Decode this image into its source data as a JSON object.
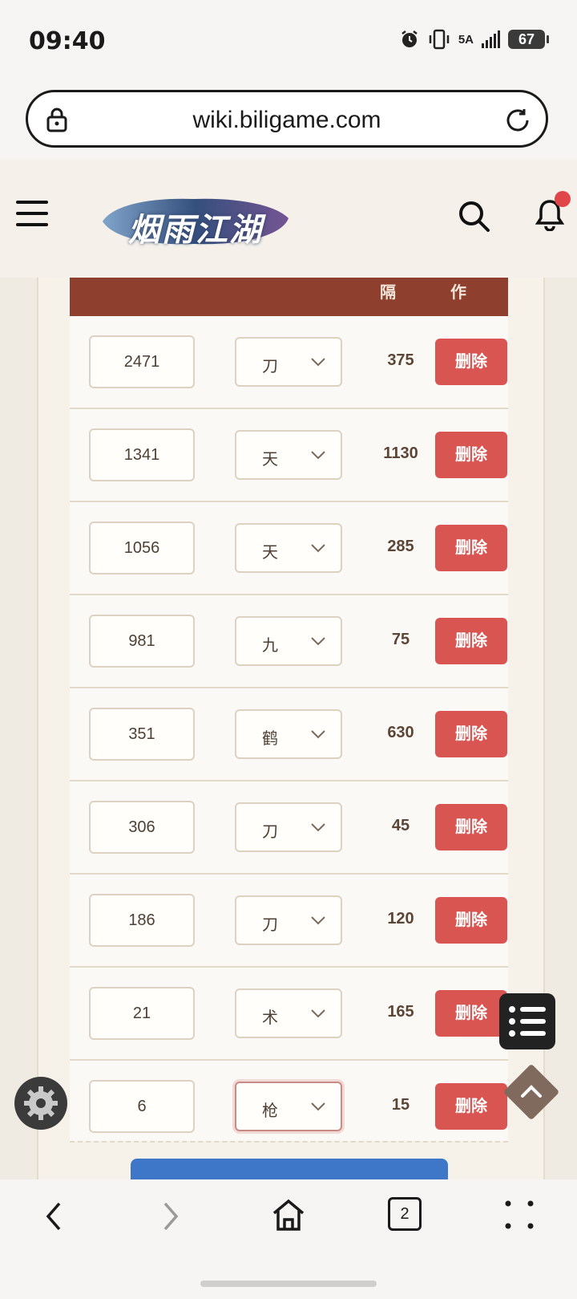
{
  "status_bar": {
    "time": "09:40",
    "signal": "5A",
    "battery": "67"
  },
  "browser": {
    "url": "wiki.biligame.com",
    "tab_count": "2"
  },
  "site": {
    "logo_text": "烟雨江湖"
  },
  "table": {
    "header": {
      "interval": "隔",
      "action": "作"
    },
    "rows": [
      {
        "number": "2471",
        "select": "刀",
        "interval": "375",
        "delete": "删除"
      },
      {
        "number": "1341",
        "select": "天",
        "interval": "1130",
        "delete": "删除"
      },
      {
        "number": "1056",
        "select": "天",
        "interval": "285",
        "delete": "删除"
      },
      {
        "number": "981",
        "select": "九",
        "interval": "75",
        "delete": "删除"
      },
      {
        "number": "351",
        "select": "鹤",
        "interval": "630",
        "delete": "删除"
      },
      {
        "number": "306",
        "select": "刀",
        "interval": "45",
        "delete": "删除"
      },
      {
        "number": "186",
        "select": "刀",
        "interval": "120",
        "delete": "删除"
      },
      {
        "number": "21",
        "select": "术",
        "interval": "165",
        "delete": "删除"
      },
      {
        "number": "6",
        "select": "枪",
        "interval": "15",
        "delete": "删除"
      }
    ]
  },
  "colors": {
    "header_bg": "#8f3f2d",
    "delete_bg": "#d95552",
    "notify_dot": "#e0454a"
  },
  "icons": [
    "lock-icon",
    "reload-icon",
    "menu-icon",
    "search-icon",
    "bell-icon",
    "chevron-down-icon",
    "list-icon",
    "chevron-up-icon",
    "gear-icon",
    "back-icon",
    "forward-icon",
    "home-icon",
    "more-icon"
  ]
}
